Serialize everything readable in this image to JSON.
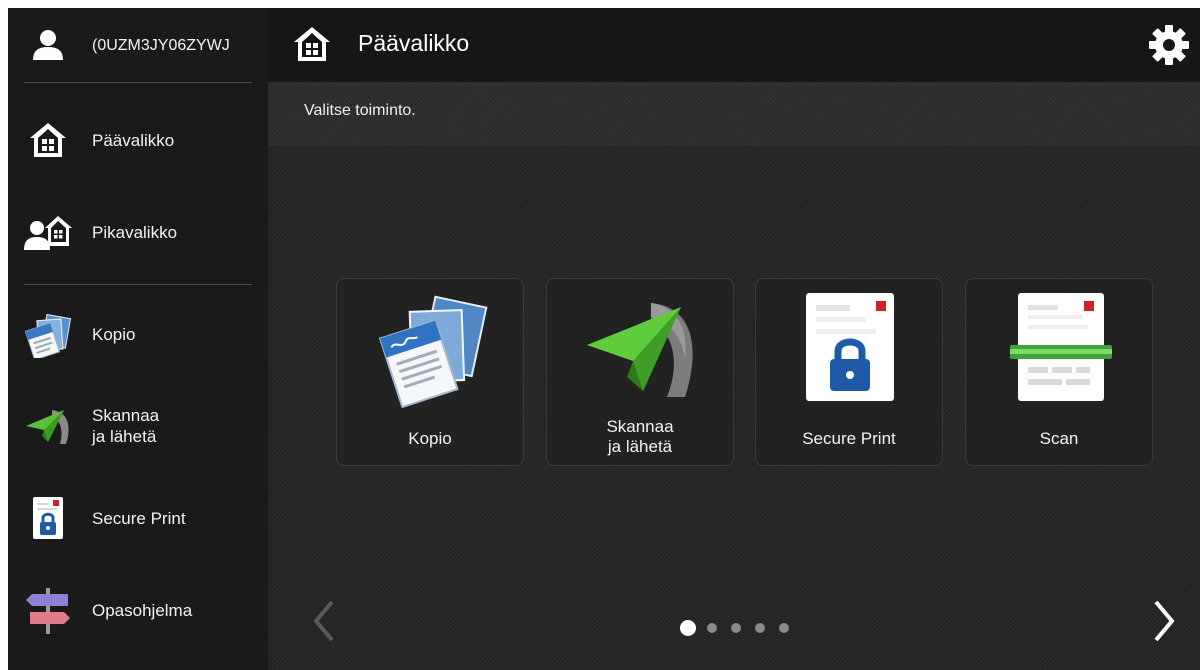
{
  "sidebar": {
    "user_id": "(0UZM3JY06ZYWJ",
    "items": [
      {
        "label": "Päävalikko",
        "icon": "home-icon"
      },
      {
        "label": "Pikavalikko",
        "icon": "quick-menu-icon"
      },
      {
        "label": "Kopio",
        "icon": "copy-icon"
      },
      {
        "label": "Skannaa\nja lähetä",
        "icon": "paper-plane-icon"
      },
      {
        "label": "Secure Print",
        "icon": "secure-print-icon"
      },
      {
        "label": "Opasohjelma",
        "icon": "signpost-icon"
      }
    ]
  },
  "header": {
    "title": "Päävalikko",
    "settings_icon": "gear-icon"
  },
  "main": {
    "prompt": "Valitse toiminto.",
    "tiles": [
      {
        "label": "Kopio",
        "icon": "copy-icon"
      },
      {
        "label": "Skannaa\nja lähetä",
        "icon": "paper-plane-icon"
      },
      {
        "label": "Secure Print",
        "icon": "secure-print-icon"
      },
      {
        "label": "Scan",
        "icon": "scan-icon"
      }
    ],
    "pagination": {
      "current_page": 1,
      "total_pages": 5
    }
  },
  "colors": {
    "accent_green": "#58c23a",
    "lock_blue": "#1f5aa6",
    "red_marker": "#d0202a"
  }
}
